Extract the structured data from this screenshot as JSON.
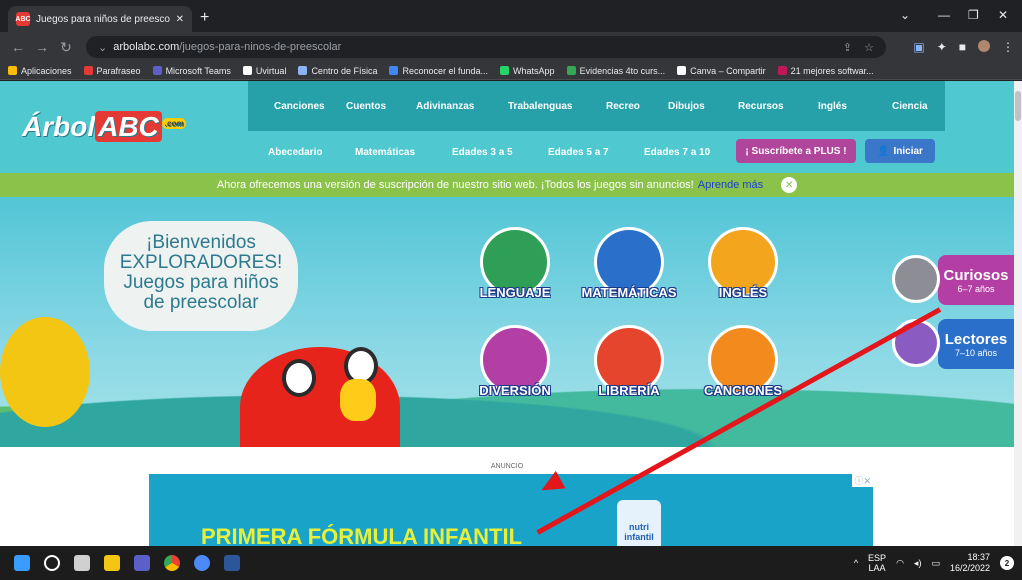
{
  "browser": {
    "tab_title": "Juegos para niños de preescolar",
    "favicon_text": "ABC",
    "url_domain": "arbolabc.com",
    "url_path": "/juegos-para-ninos-de-preescolar"
  },
  "bookmarks": [
    {
      "label": "Aplicaciones",
      "color": "#fbbc04"
    },
    {
      "label": "Parafraseo",
      "color": "#e53935"
    },
    {
      "label": "Microsoft Teams",
      "color": "#5b5fc7"
    },
    {
      "label": "Uvirtual",
      "color": "#ffffff"
    },
    {
      "label": "Centro de Física",
      "color": "#8ab4f8"
    },
    {
      "label": "Reconocer el funda...",
      "color": "#4285f4"
    },
    {
      "label": "WhatsApp",
      "color": "#25d366"
    },
    {
      "label": "Evidencias 4to curs...",
      "color": "#34a853"
    },
    {
      "label": "Canva – Compartir",
      "color": "#ffffff"
    },
    {
      "label": "21 mejores softwar...",
      "color": "#c2185b"
    }
  ],
  "site": {
    "logo_text": "Árbol",
    "logo_abc": "ABC",
    "logo_com": ".com",
    "nav_top": [
      "Canciones",
      "Cuentos",
      "Adivinanzas",
      "Trabalenguas",
      "Recreo",
      "Dibujos",
      "Recursos",
      "Inglés",
      "Ciencia"
    ],
    "nav_bottom": [
      "Abecedario",
      "Matemáticas",
      "Edades 3 a 5",
      "Edades 5 a 7",
      "Edades 7 a 10"
    ],
    "plus_button": "¡ Suscríbete a PLUS !",
    "login_button": "Iniciar",
    "notice_text": "Ahora ofrecemos una versión de suscripción de nuestro sitio web. ¡Todos los juegos sin anuncios!",
    "notice_link": "Aprende más",
    "welcome_lines": [
      "¡Bienvenidos",
      "EXPLORADORES!",
      "Juegos para niños",
      "de preescolar"
    ],
    "categories": [
      {
        "label": "LENGUAJE",
        "color": "#2f9e57"
      },
      {
        "label": "MATEMÁTICAS",
        "color": "#2a6fc9"
      },
      {
        "label": "INGLÉS",
        "color": "#f2a51d"
      },
      {
        "label": "DIVERSIÓN",
        "color": "#b43fa4"
      },
      {
        "label": "LIBRERÍA",
        "color": "#e5452c"
      },
      {
        "label": "CANCIONES",
        "color": "#f28a1d"
      }
    ],
    "side_curiosos_title": "Curiosos",
    "side_curiosos_sub": "6–7 años",
    "side_lectores_title": "Lectores",
    "side_lectores_sub": "7–10 años",
    "ad_label": "ANUNCIO",
    "ad_headline": "PRIMERA FÓRMULA INFANTIL",
    "ad_brand_top": "nutri",
    "ad_brand_bottom": "infantil"
  },
  "taskbar": {
    "lang_top": "ESP",
    "lang_bottom": "LAA",
    "time": "18:37",
    "date": "16/2/2022",
    "notifications": "2"
  }
}
